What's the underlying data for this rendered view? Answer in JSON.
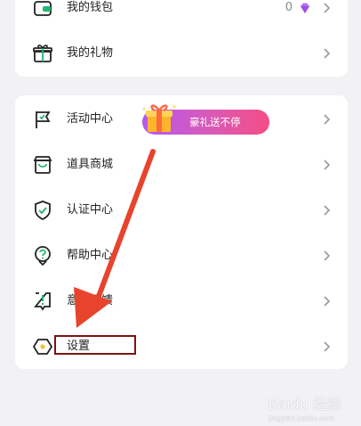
{
  "section1": {
    "items": [
      {
        "label": "我的钱包",
        "count": "0",
        "icon": "wallet-icon"
      },
      {
        "label": "我的礼物",
        "icon": "gift-icon"
      }
    ]
  },
  "section2": {
    "items": [
      {
        "label": "活动中心",
        "icon": "flag-icon"
      },
      {
        "label": "道具商城",
        "icon": "shop-icon"
      },
      {
        "label": "认证中心",
        "icon": "shield-check-icon"
      },
      {
        "label": "帮助中心",
        "icon": "help-icon"
      },
      {
        "label": "意见反馈",
        "icon": "feedback-icon"
      },
      {
        "label": "设置",
        "icon": "settings-icon"
      }
    ],
    "banner_text": "豪礼送不停"
  },
  "colors": {
    "accent_green": "#22b573",
    "highlight_border": "#7b1414",
    "arrow_red": "#e8432d"
  },
  "watermark": {
    "brand": "Baidu 经验",
    "url": "jingyan.baidu.com"
  }
}
